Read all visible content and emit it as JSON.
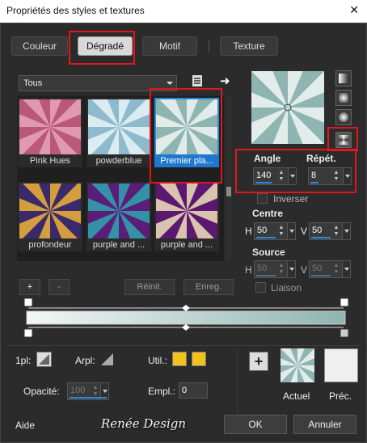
{
  "window": {
    "title": "Propriétés des styles et textures",
    "close_label": "✕"
  },
  "tabs": [
    {
      "label": "Couleur"
    },
    {
      "label": "Dégradé"
    },
    {
      "label": "Motif"
    },
    {
      "label": "Texture"
    }
  ],
  "library": {
    "selected": "Tous",
    "arrow_glyph": "➜"
  },
  "gradients": [
    {
      "name": "Pink Hues",
      "colors": [
        "#e6a5b7",
        "#b9587a"
      ]
    },
    {
      "name": "powderblue",
      "colors": [
        "#e8f3f7",
        "#8fb9cc"
      ]
    },
    {
      "name": "Premier pla...",
      "colors": [
        "#eef5f4",
        "#8fb5b1"
      ]
    },
    {
      "name": "profondeur",
      "colors": [
        "#f0b236",
        "#3a2a6b"
      ]
    },
    {
      "name": "purple and ...",
      "colors": [
        "#2fa6b0",
        "#5a1d78"
      ]
    },
    {
      "name": "purple and ...",
      "colors": [
        "#f1e2b8",
        "#5b1870"
      ]
    }
  ],
  "library_buttons": {
    "add": "+",
    "remove": "-",
    "reset": "Réinit.",
    "save": "Enreg."
  },
  "preview": {
    "colors": [
      "#f1f6f5",
      "#8fb5b2"
    ]
  },
  "params": {
    "angle_label": "Angle",
    "angle_value": "140",
    "repeat_label": "Répét.",
    "repeat_value": "8",
    "invert_label": "Inverser",
    "center_label": "Centre",
    "center_h_label": "H",
    "center_h": "50",
    "center_v_label": "V",
    "center_v": "50",
    "source_label": "Source",
    "source_h_label": "H",
    "source_h": "50",
    "source_v_label": "V",
    "source_v": "50",
    "link_label": "Liaison"
  },
  "editor": {
    "opacity_label": "Opacité:",
    "opacity_value": "100",
    "pl_label": "1pl:",
    "arpl_label": "Arpl:",
    "util_label": "Util.:",
    "empl_label": "Empl.:",
    "empl_value": "0",
    "swatch_color": "#f2c21f",
    "add_label": "+",
    "current_label": "Actuel",
    "previous_label": "Préc."
  },
  "footer": {
    "help": "Aide",
    "logo": "Renée Design",
    "ok": "OK",
    "cancel": "Annuler"
  }
}
